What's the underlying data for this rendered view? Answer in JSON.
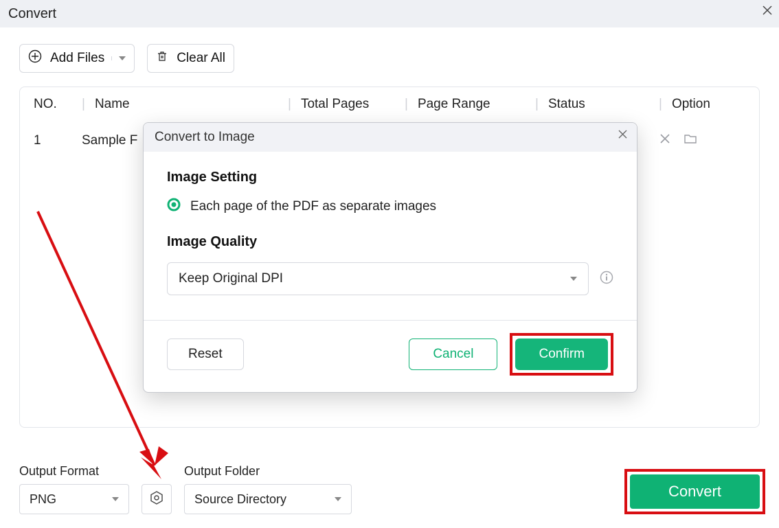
{
  "window": {
    "title": "Convert"
  },
  "toolbar": {
    "add_files_label": "Add Files",
    "clear_all_label": "Clear All"
  },
  "table": {
    "headers": {
      "no": "NO.",
      "name": "Name",
      "total_pages": "Total Pages",
      "page_range": "Page Range",
      "status": "Status",
      "option": "Option"
    },
    "rows": [
      {
        "no": "1",
        "name": "Sample F"
      }
    ]
  },
  "modal": {
    "title": "Convert to Image",
    "section_image_setting": "Image Setting",
    "radio_each_page": "Each page of the PDF as separate images",
    "section_image_quality": "Image Quality",
    "dpi_selected": "Keep Original DPI",
    "reset_label": "Reset",
    "cancel_label": "Cancel",
    "confirm_label": "Confirm"
  },
  "bottom": {
    "output_format_label": "Output Format",
    "output_format_value": "PNG",
    "output_folder_label": "Output Folder",
    "output_folder_value": "Source Directory",
    "convert_label": "Convert"
  },
  "colors": {
    "accent_green": "#0fb274",
    "annotation_red": "#d80e12"
  }
}
